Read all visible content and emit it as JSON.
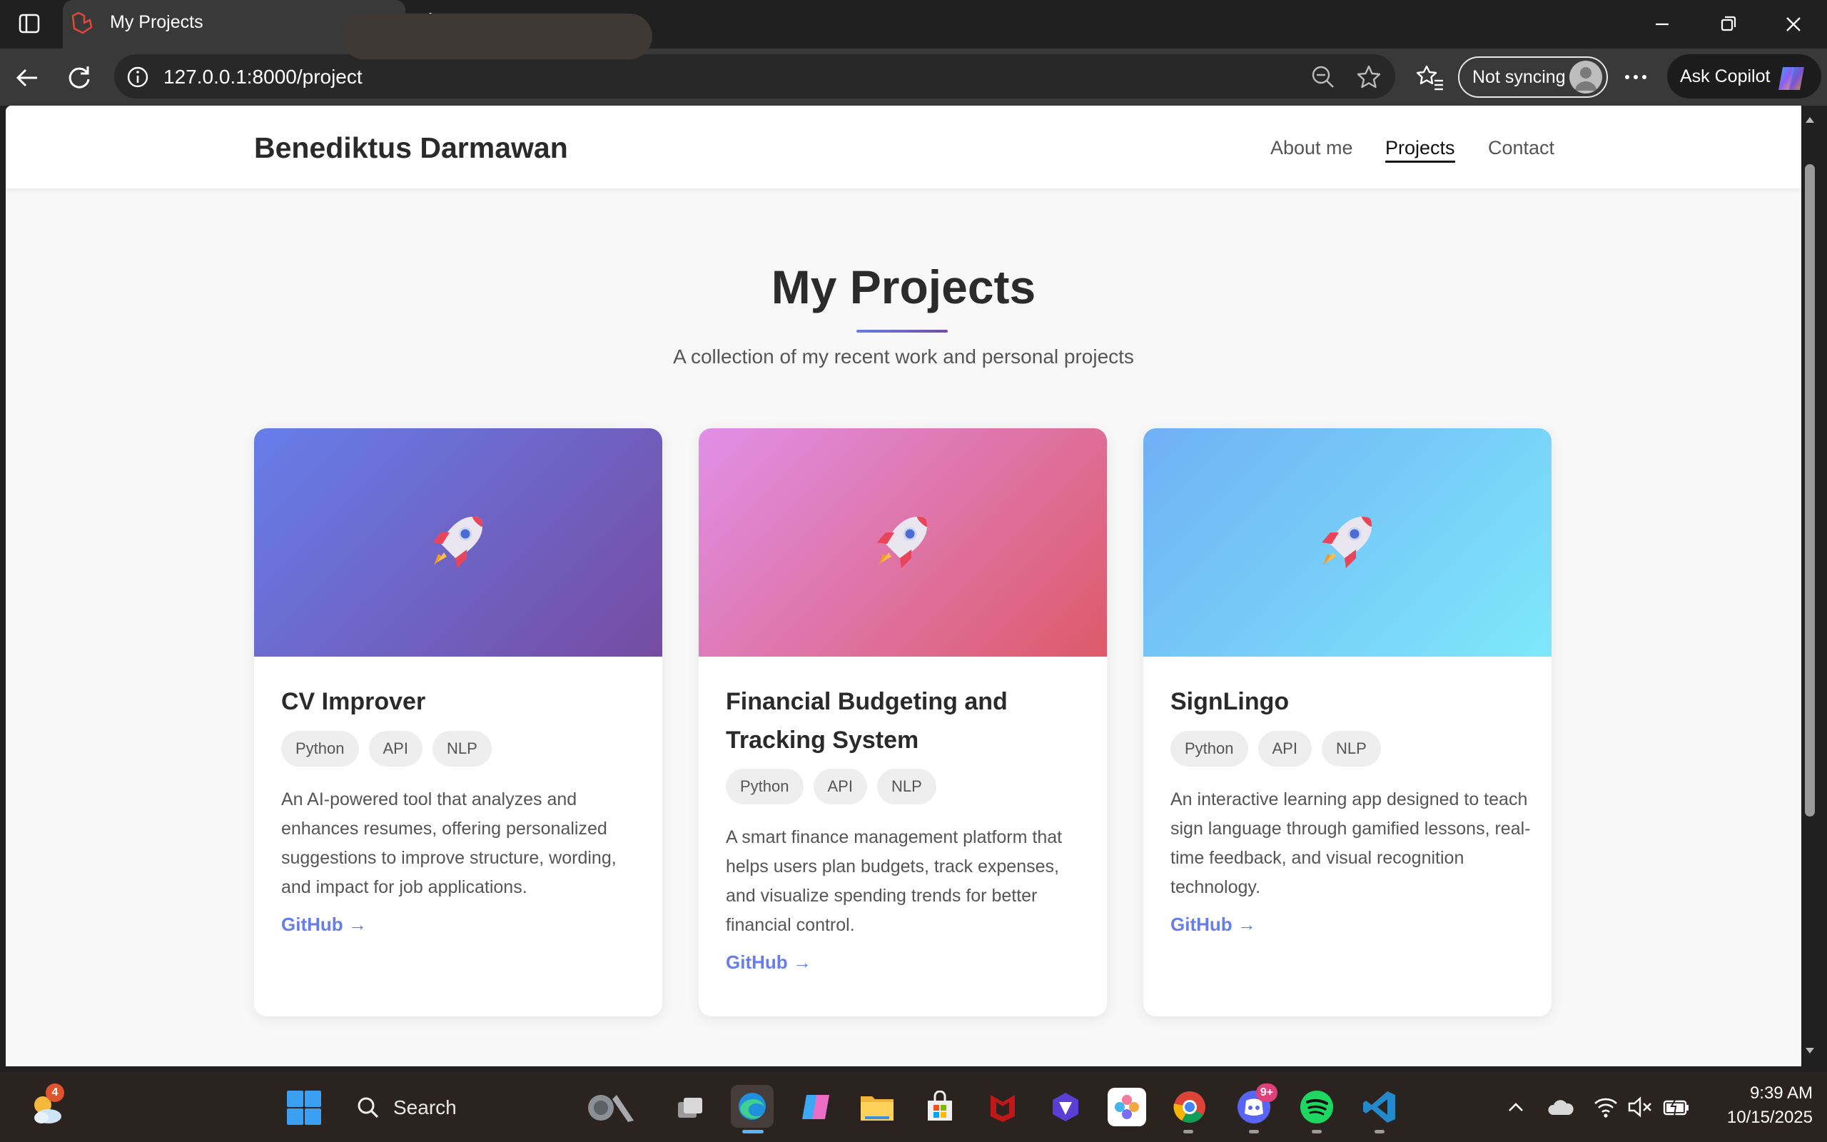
{
  "browser": {
    "tab_title": "My Projects",
    "url": "127.0.0.1:8000/project",
    "sync_label": "Not syncing",
    "copilot_label": "Ask Copilot"
  },
  "site": {
    "brand": "Benediktus Darmawan",
    "nav": [
      {
        "label": "About me",
        "active": false
      },
      {
        "label": "Projects",
        "active": true
      },
      {
        "label": "Contact",
        "active": false
      }
    ]
  },
  "page": {
    "title": "My Projects",
    "subtitle": "A collection of my recent work and personal projects"
  },
  "projects": [
    {
      "title": "CV Improver",
      "tags": [
        "Python",
        "API",
        "NLP"
      ],
      "description": "An AI-powered tool that analyzes and enhances resumes, offering personalized suggestions to improve structure, wording, and impact for job applications.",
      "link": "GitHub →",
      "gradient": [
        "#667eea",
        "#764ba2"
      ]
    },
    {
      "title": "Financial Budgeting and Tracking System",
      "tags": [
        "Python",
        "API",
        "NLP"
      ],
      "description": "A smart finance management platform that helps users plan budgets, track expenses, and visualize spending trends for better financial control.",
      "link": "GitHub →",
      "gradient": [
        "#e08fe8",
        "#dd5a68"
      ]
    },
    {
      "title": "SignLingo",
      "tags": [
        "Python",
        "API",
        "NLP"
      ],
      "description": "An interactive learning app designed to teach sign language through gamified lessons, real-time feedback, and visual recognition technology.",
      "link": "GitHub →",
      "gradient": [
        "#6fb0f5",
        "#7ee8fa"
      ]
    }
  ],
  "taskbar": {
    "search_placeholder": "Search",
    "weather_badge": "4",
    "discord_badge": "9+",
    "time": "9:39 AM",
    "date": "10/15/2025"
  }
}
